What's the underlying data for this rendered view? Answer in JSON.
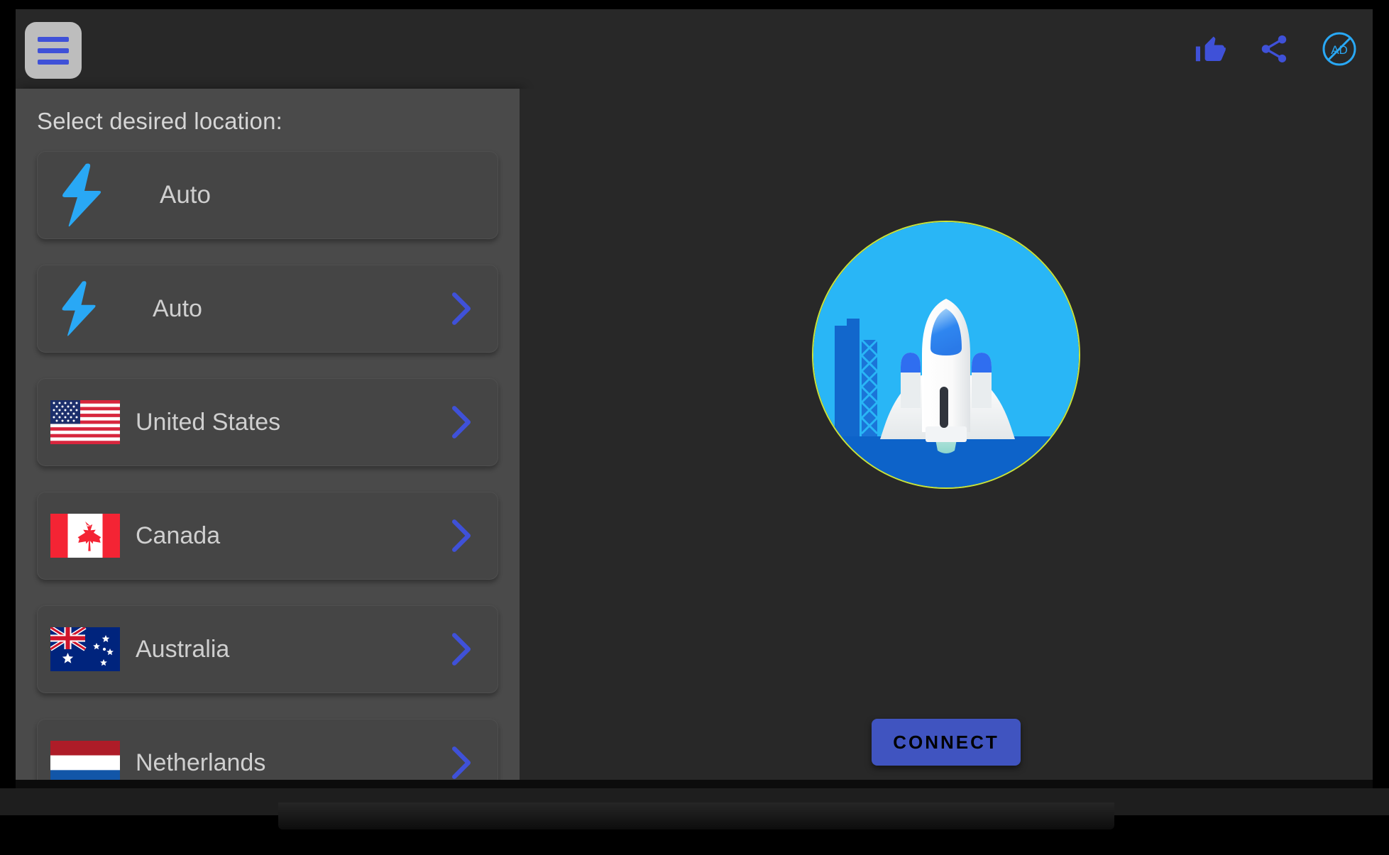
{
  "appbar": {
    "menu_button_label": "menu-button",
    "actions": [
      {
        "name": "thumbs-up-icon",
        "label": "Like",
        "color": "#3f51d8"
      },
      {
        "name": "share-icon",
        "label": "Share",
        "color": "#3f51d8"
      },
      {
        "name": "no-ad-icon",
        "label": "AD",
        "color": "#29a8f5"
      }
    ]
  },
  "sidebar": {
    "title": "Select desired location:",
    "items": [
      {
        "label": "Auto",
        "icon": "lightning-bolt-icon",
        "chevron": false
      },
      {
        "label": "Auto",
        "icon": "lightning-bolt-icon",
        "chevron": true
      },
      {
        "label": "United States",
        "icon": "flag-united-states",
        "chevron": true
      },
      {
        "label": "Canada",
        "icon": "flag-canada",
        "chevron": true
      },
      {
        "label": "Australia",
        "icon": "flag-australia",
        "chevron": true
      },
      {
        "label": "Netherlands",
        "icon": "flag-netherlands",
        "chevron": true
      }
    ]
  },
  "main": {
    "hero": {
      "name": "rocket-launch-illustration",
      "background_color": "#29b6f6",
      "ground_color": "#0d63c9",
      "ring_color": "#c9e23a"
    },
    "connect_button_label": "CONNECT",
    "connect_button_color": "#4054c0"
  },
  "colors": {
    "screen_background": "#282828",
    "sidebar_background": "#4a4a4a",
    "card_background": "#454545",
    "accent_blue": "#3f51d8",
    "bolt_blue": "#29a8f5",
    "text_primary": "#cfcfcf"
  }
}
